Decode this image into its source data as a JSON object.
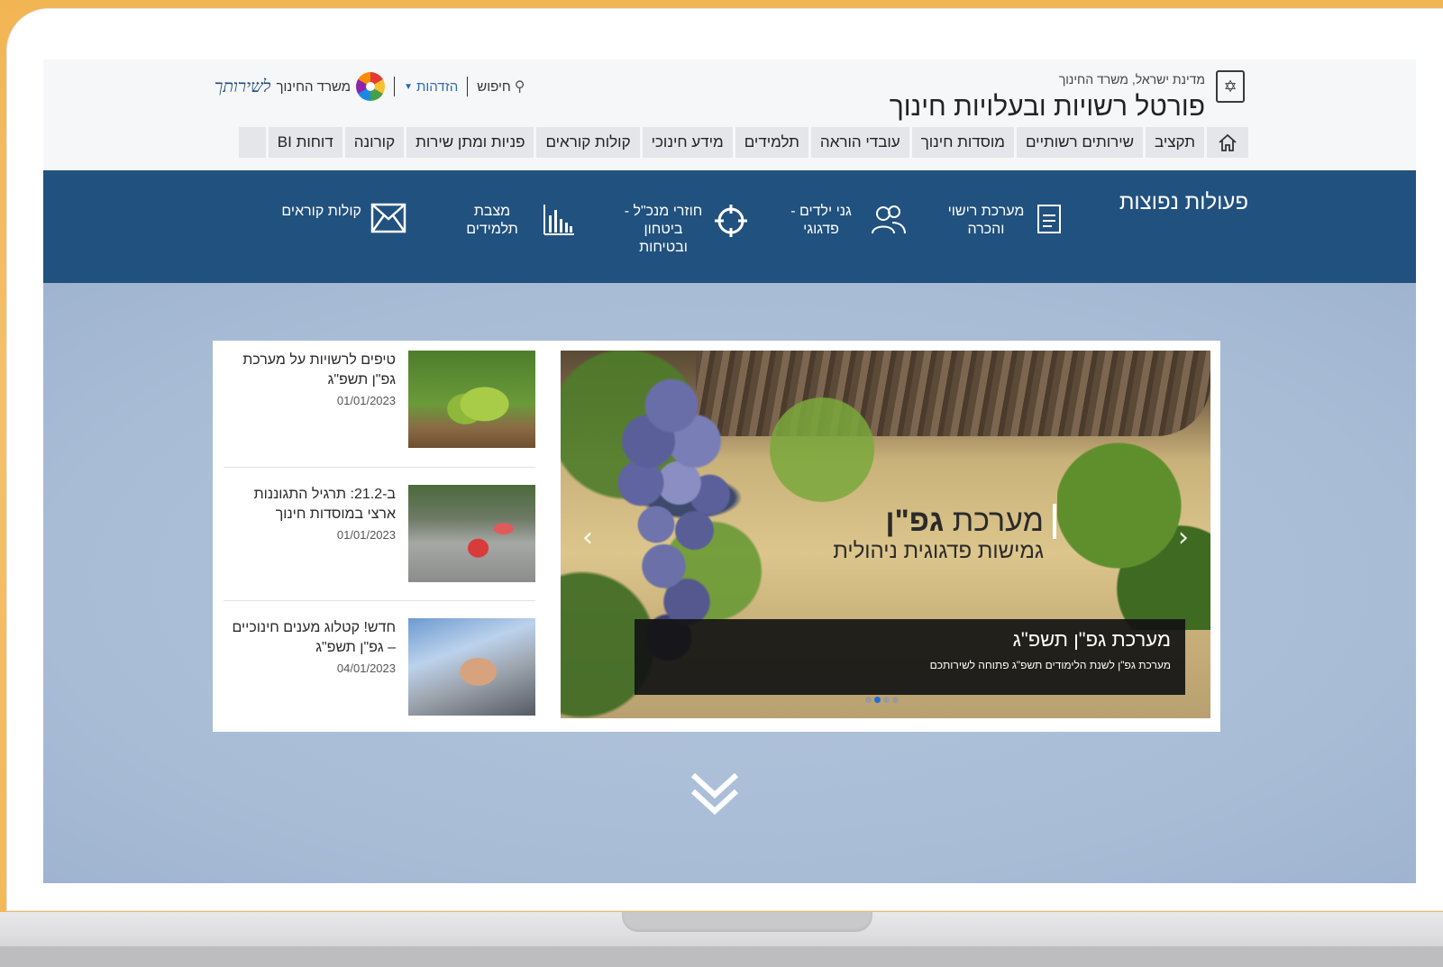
{
  "header": {
    "gov_line": "מדינת ישראל, משרד החינוך",
    "portal_title": "פורטל רשויות ובעלויות חינוך",
    "ministry_logo_text": "משרד החינוך",
    "ministry_logo_script": "לשירותך",
    "login_label": "הזדהות",
    "search_label": "חיפוש"
  },
  "nav": {
    "items": [
      {
        "label": "תקציב"
      },
      {
        "label": "שירותים רשותיים"
      },
      {
        "label": "מוסדות חינוך"
      },
      {
        "label": "עובדי הוראה"
      },
      {
        "label": "תלמידים"
      },
      {
        "label": "מידע חינוכי"
      },
      {
        "label": "קולות קוראים"
      },
      {
        "label": "פניות ומתן שירות"
      },
      {
        "label": "קורונה"
      },
      {
        "label": "דוחות BI"
      }
    ]
  },
  "quick_actions": {
    "title": "פעולות נפוצות",
    "items": [
      {
        "label": "מערכת רישוי והכרה",
        "icon": "document-icon"
      },
      {
        "label": "גני ילדים - פדגוגי",
        "icon": "users-icon"
      },
      {
        "label": "חוזרי מנכ\"ל - ביטחון ובטיחות",
        "icon": "crosshair-icon"
      },
      {
        "label": "מצבת תלמידים",
        "icon": "bar-chart-icon"
      },
      {
        "label": "קולות קוראים",
        "icon": "envelope-icon"
      }
    ]
  },
  "slider": {
    "logo_main_light": "מערכת",
    "logo_main_bold": "גפ\"ן",
    "logo_sub": "גמישות פדגוגית ניהולית",
    "caption_title": "מערכת גפ\"ן תשפ\"ג",
    "caption_text": "מערכת גפ\"ן לשנת הלימודים תשפ\"ג פתוחה לשירותכם",
    "prev_arrow": "‹",
    "next_arrow": "›",
    "dots_count": 4,
    "active_dot": 2
  },
  "news": [
    {
      "title": "טיפים לרשויות על מערכת גפ\"ן תשפ\"ג",
      "date": "01/01/2023",
      "thumb": "grapes"
    },
    {
      "title": "ב-21.2: תרגיל התגוננות ארצי במוסדות חינוך",
      "date": "01/01/2023",
      "thumb": "kids"
    },
    {
      "title": "חדש! קטלוג מענים חינוכיים – גפ\"ן תשפ\"ג",
      "date": "04/01/2023",
      "thumb": "laptop"
    }
  ],
  "colors": {
    "background_orange": "#f2b554",
    "actions_band": "#21517f",
    "main_area": "#a8bcd6",
    "link_blue": "#2b6bb0",
    "active_dot": "#1e6fd9"
  }
}
